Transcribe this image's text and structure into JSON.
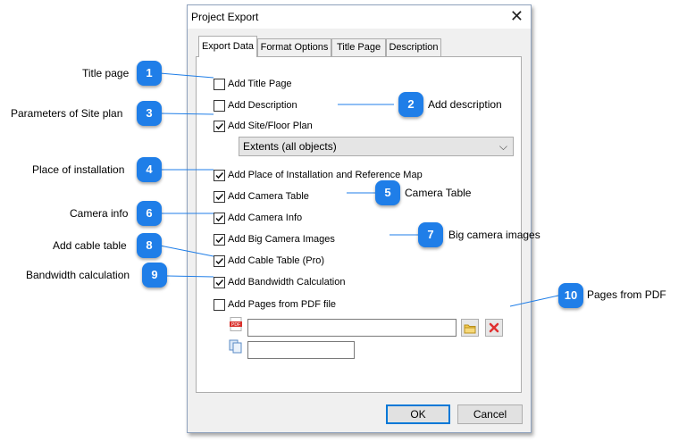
{
  "dialog": {
    "title": "Project Export",
    "close_icon": "close-icon",
    "tabs": [
      {
        "label": "Export Data",
        "active": true
      },
      {
        "label": "Format Options",
        "active": false
      },
      {
        "label": "Title Page",
        "active": false
      },
      {
        "label": "Description",
        "active": false
      }
    ],
    "options": [
      {
        "label": "Add Title Page",
        "checked": false
      },
      {
        "label": "Add Description",
        "checked": false
      },
      {
        "label": "Add Site/Floor Plan",
        "checked": true
      },
      {
        "label": "Add Place of Installation and Reference Map",
        "checked": true
      },
      {
        "label": "Add Camera Table",
        "checked": true
      },
      {
        "label": "Add Camera Info",
        "checked": true
      },
      {
        "label": "Add Big Camera Images",
        "checked": true
      },
      {
        "label": "Add Cable Table (Pro)",
        "checked": true
      },
      {
        "label": "Add Bandwidth Calculation",
        "checked": true
      },
      {
        "label": "Add Pages from PDF file",
        "checked": false
      }
    ],
    "site_plan_select": {
      "value": "Extents (all objects)"
    },
    "pdf_file_input": {
      "value": "",
      "icon": "pdf-file-icon"
    },
    "pdf_pages_input": {
      "value": "",
      "icon": "pages-icon"
    },
    "browse_icon": "folder-icon",
    "clear_icon": "red-x-icon",
    "ok_label": "OK",
    "cancel_label": "Cancel"
  },
  "annotations": {
    "a1": {
      "num": "1",
      "text": "Title page"
    },
    "a2": {
      "num": "2",
      "text": "Add description"
    },
    "a3": {
      "num": "3",
      "text": "Parameters of Site plan"
    },
    "a4": {
      "num": "4",
      "text": "Place of installation"
    },
    "a5": {
      "num": "5",
      "text": "Camera Table"
    },
    "a6": {
      "num": "6",
      "text": "Camera info"
    },
    "a7": {
      "num": "7",
      "text": "Big camera images"
    },
    "a8": {
      "num": "8",
      "text": "Add cable table"
    },
    "a9": {
      "num": "9",
      "text": "Bandwidth calculation"
    },
    "a10": {
      "num": "10",
      "text": "Pages from PDF"
    }
  },
  "colors": {
    "badge": "#1f7ee8",
    "leader_line": "#1f7ee8",
    "accent": "#0078d7"
  }
}
